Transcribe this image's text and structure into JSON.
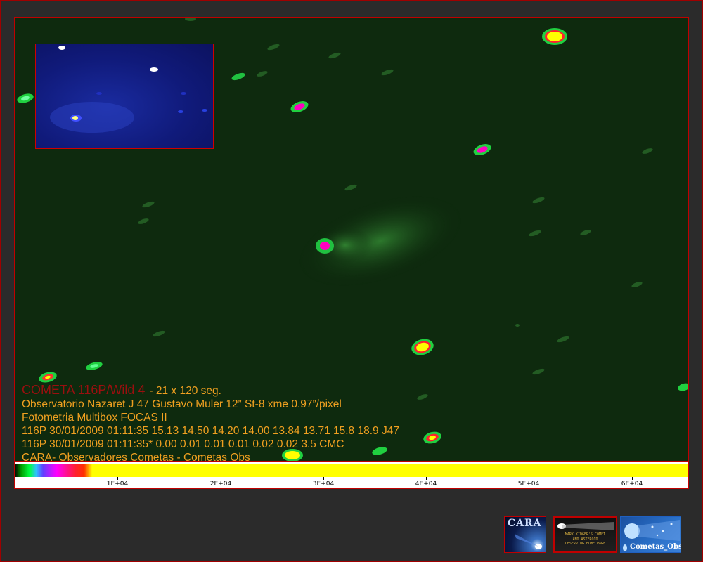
{
  "caption": {
    "title": "COMETA 116P/Wild 4",
    "title_suffix": "- 21 x 120 seg.",
    "lines": [
      "Observatorio Nazaret J 47 Gustavo Muler 12” St-8 xme 0.97”/pixel",
      "Fotometria Multibox FOCAS II",
      "116P 30/01/2009 01:11:35 15.13 14.50 14.20 14.00 13.84 13.71 15.8 18.9 J47",
      "116P 30/01/2009 01:11:35* 0.00 0.01 0.01 0.01 0.02 0.02 3.5 CMC",
      "CARA- Observadores Cometas - Cometas Obs"
    ]
  },
  "scale": {
    "ticks": [
      {
        "label": "1E+04",
        "value": 10000
      },
      {
        "label": "2E+04",
        "value": 20000
      },
      {
        "label": "3E+04",
        "value": 30000
      },
      {
        "label": "4E+04",
        "value": 40000
      },
      {
        "label": "5E+04",
        "value": 50000
      },
      {
        "label": "6E+04",
        "value": 60000
      }
    ],
    "max": 65500
  },
  "badges": {
    "cara": "CARA",
    "kidger": "MARK KIDGER'S COMET\nAND ASTEROID\nOBSERVING HOME PAGE",
    "cometas": "Cometas_Obs"
  },
  "colors": {
    "caption_text": "#f0a020",
    "caption_title": "#9a0f0f",
    "frame_border": "#c00000",
    "sky_background": "#0e2a0e"
  }
}
